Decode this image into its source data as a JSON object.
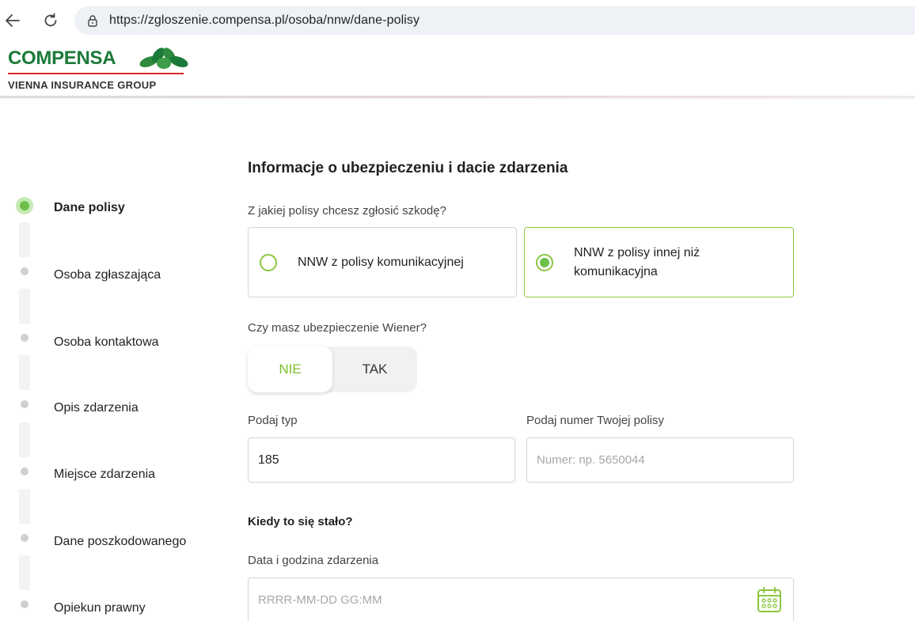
{
  "browser": {
    "url": "https://zgloszenie.compensa.pl/osoba/nnw/dane-polisy"
  },
  "header": {
    "logo_word": "COMPENSA",
    "logo_subtitle": "VIENNA INSURANCE GROUP",
    "brand_green": "#1b7a3a",
    "brand_red": "#d8262b"
  },
  "steps": [
    {
      "label": "Dane polisy",
      "active": true
    },
    {
      "label": "Osoba zgłaszająca",
      "active": false
    },
    {
      "label": "Osoba kontaktowa",
      "active": false
    },
    {
      "label": "Opis zdarzenia",
      "active": false
    },
    {
      "label": "Miejsce zdarzenia",
      "active": false
    },
    {
      "label": "Dane poszkodowanego",
      "active": false
    },
    {
      "label": "Opiekun prawny",
      "active": false
    }
  ],
  "form": {
    "title": "Informacje o ubezpieczeniu i dacie zdarzenia",
    "policy_question": "Z jakiej polisy chcesz zgłosić szkodę?",
    "policy_options": [
      {
        "label": "NNW z polisy komunikacyjnej",
        "selected": false
      },
      {
        "label": "NNW z polisy innej niż komunikacyjna",
        "selected": true
      }
    ],
    "wiener_question": "Czy masz ubezpieczenie Wiener?",
    "wiener_toggle": {
      "no": "NIE",
      "yes": "TAK",
      "selected": "NIE"
    },
    "type_label": "Podaj typ",
    "type_value": "185",
    "policy_number_label": "Podaj numer Twojej polisy",
    "policy_number_placeholder": "Numer: np. 5650044",
    "when_heading": "Kiedy to się stało?",
    "datetime_label": "Data i godzina zdarzenia",
    "datetime_placeholder": "RRRR-MM-DD GG:MM"
  },
  "colors": {
    "accent_green": "#6cc04a",
    "toggle_active_text": "#7cbf2a"
  }
}
